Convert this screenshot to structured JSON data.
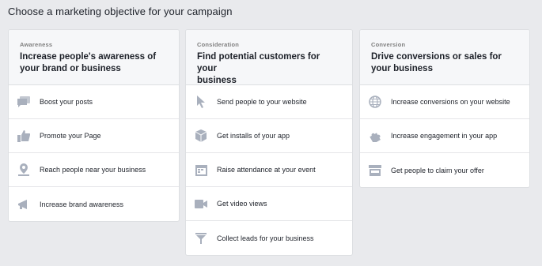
{
  "page": {
    "title": "Choose a marketing objective for your campaign"
  },
  "columns": [
    {
      "kicker": "Awareness",
      "title_line1": "Increase people's awareness of",
      "title_line2": "your brand or business",
      "items": [
        {
          "label": "Boost your posts",
          "icon": "speech-bubble-icon"
        },
        {
          "label": "Promote your Page",
          "icon": "thumbs-up-icon"
        },
        {
          "label": "Reach people near your business",
          "icon": "location-pin-icon"
        },
        {
          "label": "Increase brand awareness",
          "icon": "megaphone-icon"
        }
      ]
    },
    {
      "kicker": "Consideration",
      "title_line1": "Find potential customers for your",
      "title_line2": "business",
      "items": [
        {
          "label": "Send people to your website",
          "icon": "cursor-icon"
        },
        {
          "label": "Get installs of your app",
          "icon": "box-icon"
        },
        {
          "label": "Raise attendance at your event",
          "icon": "calendar-icon"
        },
        {
          "label": "Get video views",
          "icon": "video-camera-icon"
        },
        {
          "label": "Collect leads for your business",
          "icon": "funnel-icon"
        }
      ]
    },
    {
      "kicker": "Conversion",
      "title_line1": "Drive conversions or sales for",
      "title_line2": "your business",
      "items": [
        {
          "label": "Increase conversions on your website",
          "icon": "globe-icon"
        },
        {
          "label": "Increase engagement in your app",
          "icon": "puzzle-icon"
        },
        {
          "label": "Get people to claim your offer",
          "icon": "storefront-icon"
        }
      ]
    }
  ],
  "colors": {
    "icon": "#a9b0bd",
    "background": "#e9eaed",
    "card_header": "#f6f7f9",
    "border": "#dddfe2"
  }
}
